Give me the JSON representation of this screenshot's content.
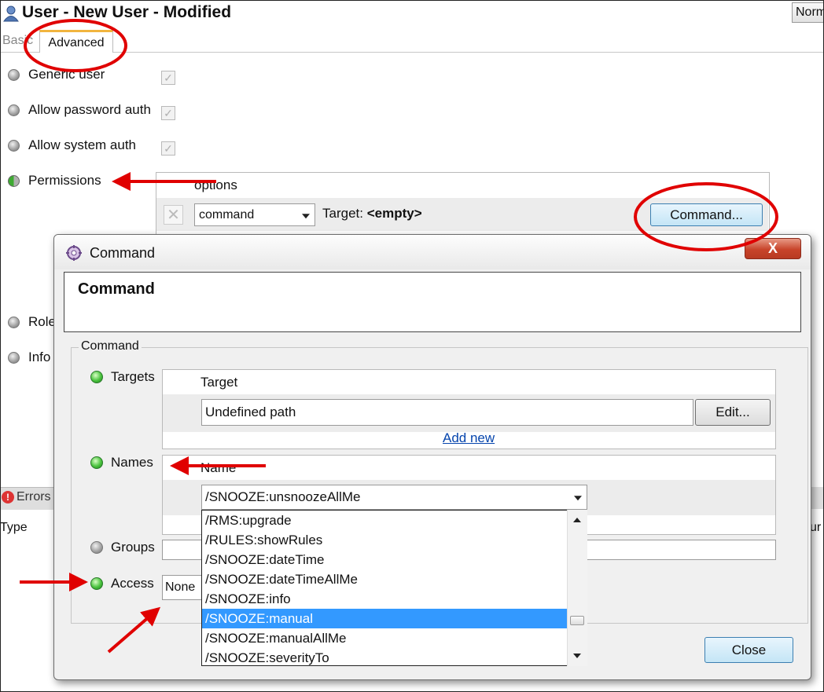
{
  "window": {
    "title": "User - New User - Modified",
    "norm_button": "Norm",
    "tabs": {
      "basic": "Basic",
      "advanced": "Advanced"
    },
    "properties": {
      "generic_user": "Generic user",
      "allow_password_auth": "Allow password auth",
      "allow_system_auth": "Allow system auth",
      "permissions": "Permissions",
      "roles": "Role",
      "info": "Info"
    },
    "permissions_panel": {
      "header": "options",
      "remove_icon": "✕",
      "command_value": "command",
      "target_label": "Target:",
      "target_value": "<empty>",
      "command_button": "Command..."
    },
    "errors_tab": "Errors",
    "type_column": "Type",
    "right_column": "ur"
  },
  "dialog": {
    "title": "Command",
    "header_title": "Command",
    "close_x": "X",
    "group_label": "Command",
    "targets": {
      "label": "Targets",
      "column_header": "Target",
      "path_value": "Undefined path",
      "edit_button": "Edit...",
      "add_new": "Add new"
    },
    "names": {
      "label": "Names",
      "column_header": "Name",
      "selected": "/SNOOZE:unsnoozeAllMe",
      "options": [
        "/RMS:upgrade",
        "/RULES:showRules",
        "/SNOOZE:dateTime",
        "/SNOOZE:dateTimeAllMe",
        "/SNOOZE:info",
        "/SNOOZE:manual",
        "/SNOOZE:manualAllMe",
        "/SNOOZE:severityTo"
      ],
      "highlighted_option": "/SNOOZE:manual"
    },
    "groups": {
      "label": "Groups"
    },
    "access": {
      "label": "Access",
      "value": "None"
    },
    "close_button": "Close"
  },
  "colors": {
    "annotation_red": "#e00000",
    "selection_blue": "#3399ff",
    "status_green": "#49c23d",
    "status_gray": "#a5a5a5"
  }
}
